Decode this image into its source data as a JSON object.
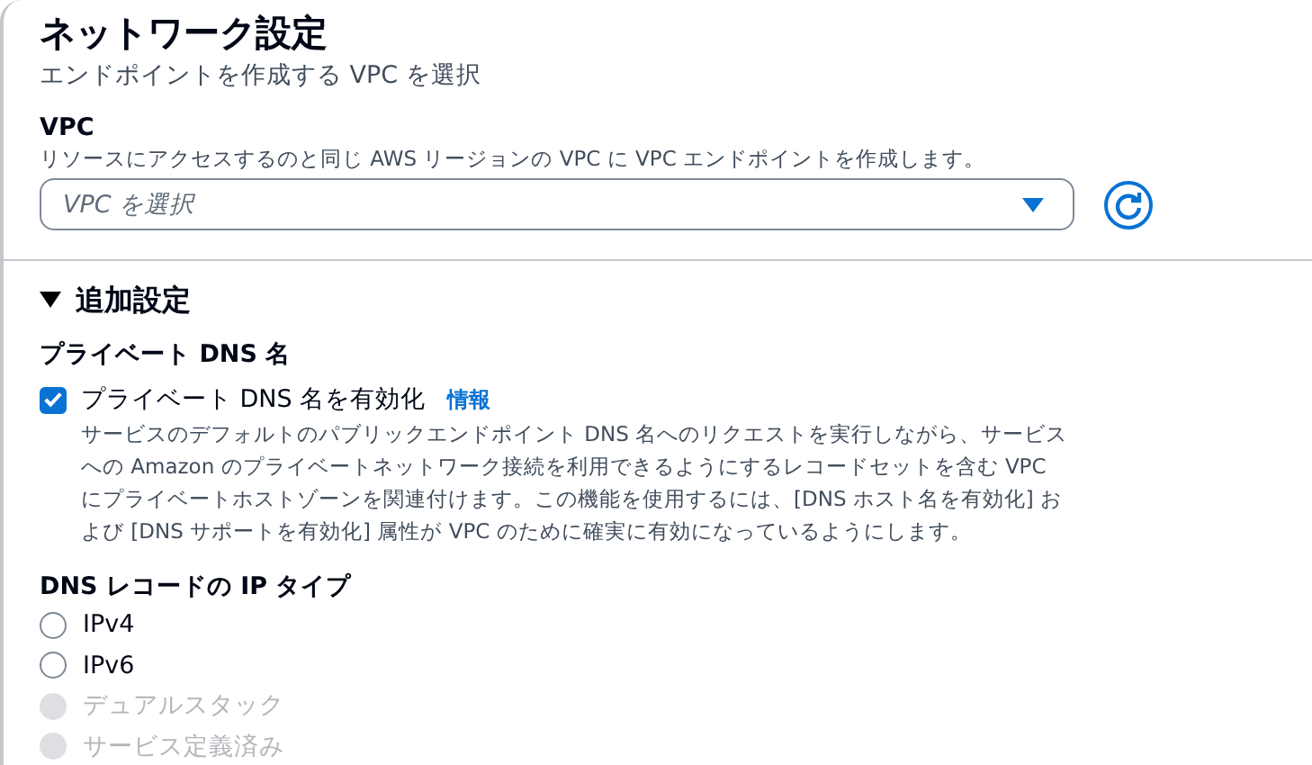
{
  "section": {
    "title": "ネットワーク設定",
    "subtitle": "エンドポイントを作成する VPC を選択"
  },
  "vpc": {
    "label": "VPC",
    "description": "リソースにアクセスするのと同じ AWS リージョンの VPC に VPC エンドポイントを作成します。",
    "placeholder": "VPC を選択"
  },
  "additional": {
    "title": "追加設定",
    "expanded": true,
    "private_dns": {
      "heading": "プライベート DNS 名",
      "label": "プライベート DNS 名を有効化",
      "checked": true,
      "info": "情報",
      "description_lines": [
        "サービスのデフォルトのパブリックエンドポイント DNS 名へのリクエストを実行しながら、サービス",
        "への Amazon のプライベートネットワーク接続を利用できるようにするレコードセットを含む VPC",
        "にプライベートホストゾーンを関連付けます。この機能を使用するには、[DNS ホスト名を有効化] お",
        "よび [DNS サポートを有効化] 属性が VPC のために確実に有効になっているようにします。"
      ]
    },
    "ip_type": {
      "heading": "DNS レコードの IP タイプ",
      "options": [
        {
          "label": "IPv4",
          "selected": false,
          "disabled": false
        },
        {
          "label": "IPv6",
          "selected": false,
          "disabled": false
        },
        {
          "label": "デュアルスタック",
          "selected": false,
          "disabled": true
        },
        {
          "label": "サービス定義済み",
          "selected": false,
          "disabled": true
        }
      ]
    }
  }
}
